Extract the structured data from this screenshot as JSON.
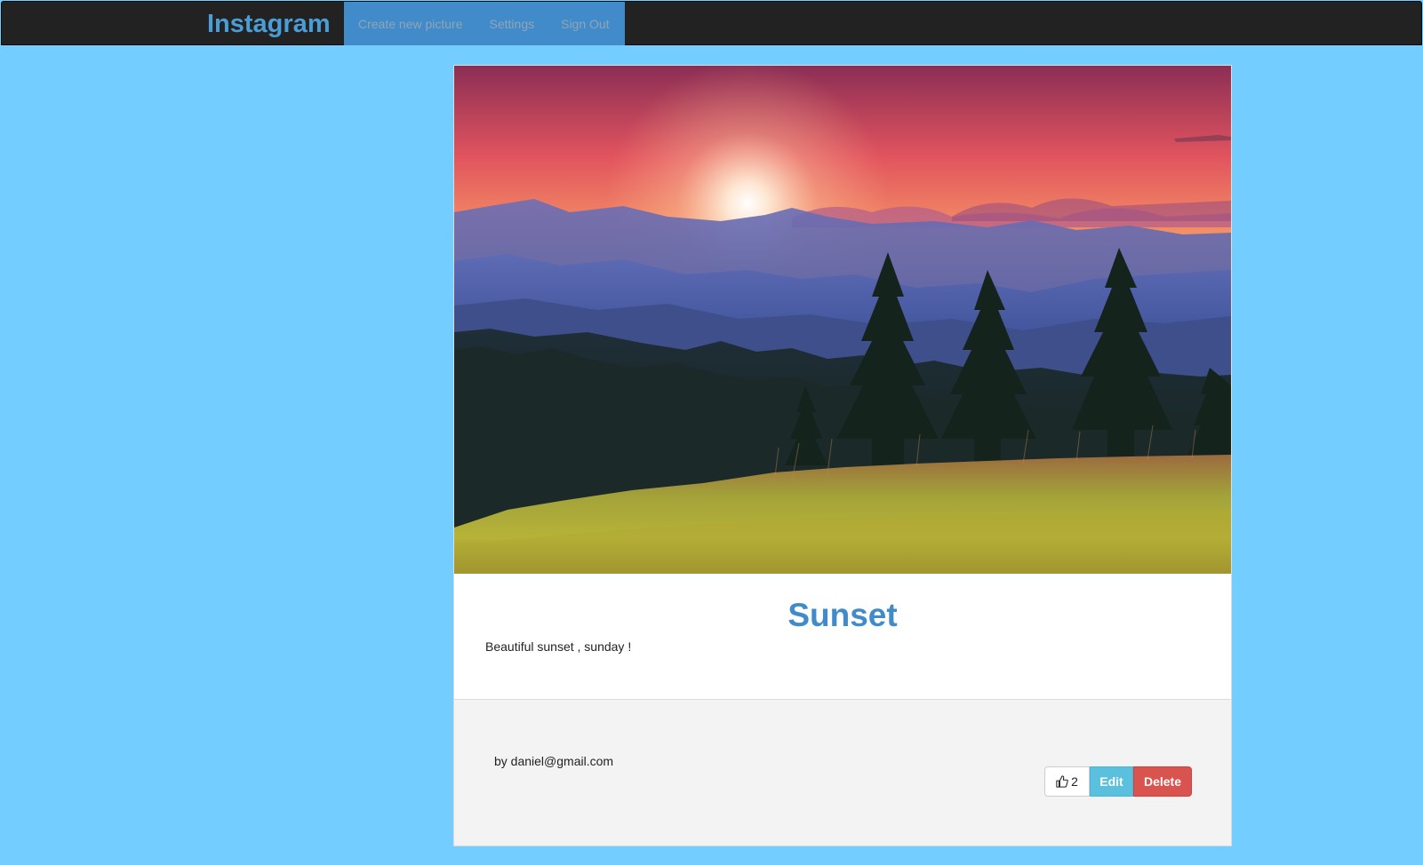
{
  "navbar": {
    "brand": "Instagram",
    "links": [
      {
        "label": "Create new picture"
      },
      {
        "label": "Settings"
      },
      {
        "label": "Sign Out"
      }
    ]
  },
  "post": {
    "title": "Sunset",
    "description": "Beautiful sunset , sunday !",
    "author": "by daniel@gmail.com",
    "likes": "2",
    "like_icon": "thumbs-up-icon",
    "edit_label": "Edit",
    "delete_label": "Delete"
  },
  "colors": {
    "page_background": "#73cdff",
    "navbar_background": "#222222",
    "brand": "#4a9dd5",
    "nav_menu_background": "#428bca",
    "title": "#428bca",
    "edit_button": "#5bc0de",
    "delete_button": "#d9534f"
  }
}
